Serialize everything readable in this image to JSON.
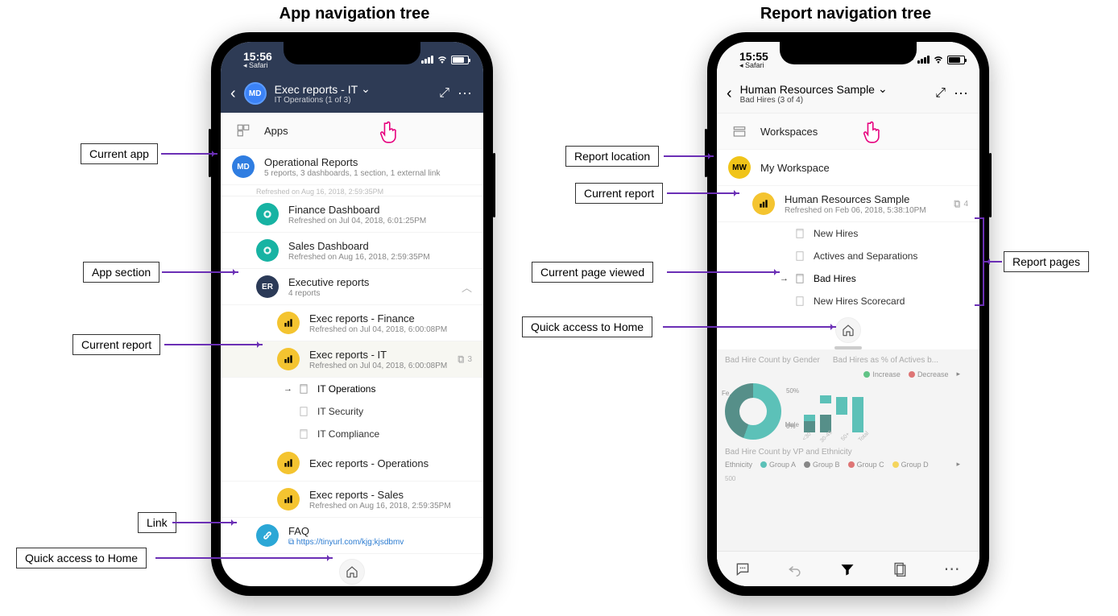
{
  "titles": {
    "left": "App navigation tree",
    "right": "Report navigation tree"
  },
  "callouts": {
    "currentApp": "Current app",
    "appSection": "App section",
    "currentReport": "Current report",
    "link": "Link",
    "quickHome": "Quick access to Home",
    "reportLocation": "Report location",
    "currentReport2": "Current report",
    "currentPage": "Current page viewed",
    "quickHome2": "Quick access to Home",
    "reportPages": "Report pages"
  },
  "left": {
    "status": {
      "time": "15:56",
      "safari": "◂ Safari"
    },
    "header": {
      "avatar": "MD",
      "title": "Exec reports - IT",
      "subtitle": "IT Operations (1 of 3)"
    },
    "groupApps": "Apps",
    "appRow": {
      "avatar": "MD",
      "title": "Operational Reports",
      "sub": "5 reports, 3 dashboards, 1 section, 1 external link"
    },
    "partialSub": "Refreshed on Aug 16, 2018, 2:59:35PM",
    "dash1": {
      "title": "Finance Dashboard",
      "sub": "Refreshed on Jul 04, 2018, 6:01:25PM"
    },
    "dash2": {
      "title": "Sales Dashboard",
      "sub": "Refreshed on Aug 16, 2018, 2:59:35PM"
    },
    "section": {
      "avatar": "ER",
      "title": "Executive reports",
      "sub": "4 reports"
    },
    "r1": {
      "title": "Exec reports - Finance",
      "sub": "Refreshed on Jul 04, 2018, 6:00:08PM"
    },
    "r2": {
      "title": "Exec reports - IT",
      "sub": "Refreshed on Jul 04, 2018, 6:00:08PM",
      "count": "3"
    },
    "pages": {
      "p1": "IT Operations",
      "p2": "IT Security",
      "p3": "IT Compliance"
    },
    "r3": {
      "title": "Exec reports - Operations"
    },
    "r4": {
      "title": "Exec reports - Sales",
      "sub": "Refreshed on Aug 16, 2018, 2:59:35PM"
    },
    "link": {
      "title": "FAQ",
      "url": "https://tinyurl.com/kjg;kjsdbmv"
    }
  },
  "right": {
    "status": {
      "time": "15:55",
      "safari": "◂ Safari"
    },
    "header": {
      "title": "Human Resources Sample",
      "subtitle": "Bad Hires (3 of 4)"
    },
    "groupWorkspaces": "Workspaces",
    "ws": {
      "avatar": "MW",
      "title": "My Workspace"
    },
    "rep": {
      "title": "Human Resources Sample",
      "sub": "Refreshed on Feb 06, 2018, 5:38:10PM",
      "count": "4"
    },
    "pages": {
      "p1": "New Hires",
      "p2": "Actives and Separations",
      "p3": "Bad Hires",
      "p4": "New Hires Scorecard"
    },
    "preview": {
      "t1": "Bad Hire Count by Gender",
      "t2": "Bad Hires as % of Actives b...",
      "leg1": "Increase",
      "leg2": "Decrease",
      "female": "Fe...",
      "male": "Male",
      "y50": "50%",
      "y0": "0%",
      "x1": "<30",
      "x2": "30-49",
      "x3": "50+",
      "x4": "Total",
      "t3": "Bad Hire Count by VP and Ethnicity",
      "ethLabel": "Ethnicity",
      "ga": "Group A",
      "gb": "Group B",
      "gc": "Group C",
      "gd": "Group D",
      "y500": "500"
    }
  }
}
